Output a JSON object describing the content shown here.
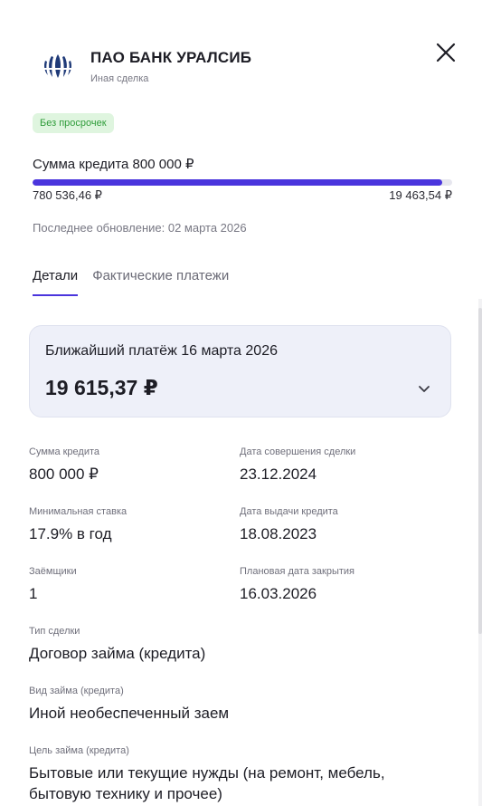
{
  "header": {
    "bank_name": "ПАО БАНК УРАЛСИБ",
    "deal_type": "Иная сделка",
    "logo_icon": "uralsib-logo-icon",
    "close_icon": "close-icon"
  },
  "status_badge": "Без просрочек",
  "credit": {
    "sum_label": "Сумма кредита 800 000 ₽",
    "paid": "780 536,46 ₽",
    "remaining": "19 463,54 ₽",
    "paid_fraction": 0.976
  },
  "updated": "Последнее обновление: 02 марта 2026",
  "tabs": [
    {
      "label": "Детали",
      "active": true
    },
    {
      "label": "Фактические платежи",
      "active": false
    }
  ],
  "next_payment": {
    "title": "Ближайший платёж 16 марта 2026",
    "amount": "19 615,37 ₽"
  },
  "details": {
    "credit_sum": {
      "label": "Сумма кредита",
      "value": "800 000 ₽"
    },
    "deal_date": {
      "label": "Дата совершения сделки",
      "value": "23.12.2024"
    },
    "min_rate": {
      "label": "Минимальная ставка",
      "value": "17.9% в год"
    },
    "issue_date": {
      "label": "Дата выдачи кредита",
      "value": "18.08.2023"
    },
    "borrowers": {
      "label": "Заёмщики",
      "value": "1"
    },
    "close_date": {
      "label": "Плановая дата закрытия",
      "value": "16.03.2026"
    },
    "deal_kind": {
      "label": "Тип сделки",
      "value": "Договор займа (кредита)"
    },
    "loan_kind": {
      "label": "Вид займа (кредита)",
      "value": "Иной необеспеченный заем"
    },
    "loan_purpose": {
      "label": "Цель займа (кредита)",
      "value": "Бытовые или текущие нужды (на ремонт, мебель, бытовую технику и прочее)"
    }
  },
  "colors": {
    "accent": "#4a35dd",
    "badge_bg": "#dff5df",
    "badge_text": "#2f9c3a",
    "card_bg": "#eef0f9",
    "logo": "#1f3a78"
  }
}
